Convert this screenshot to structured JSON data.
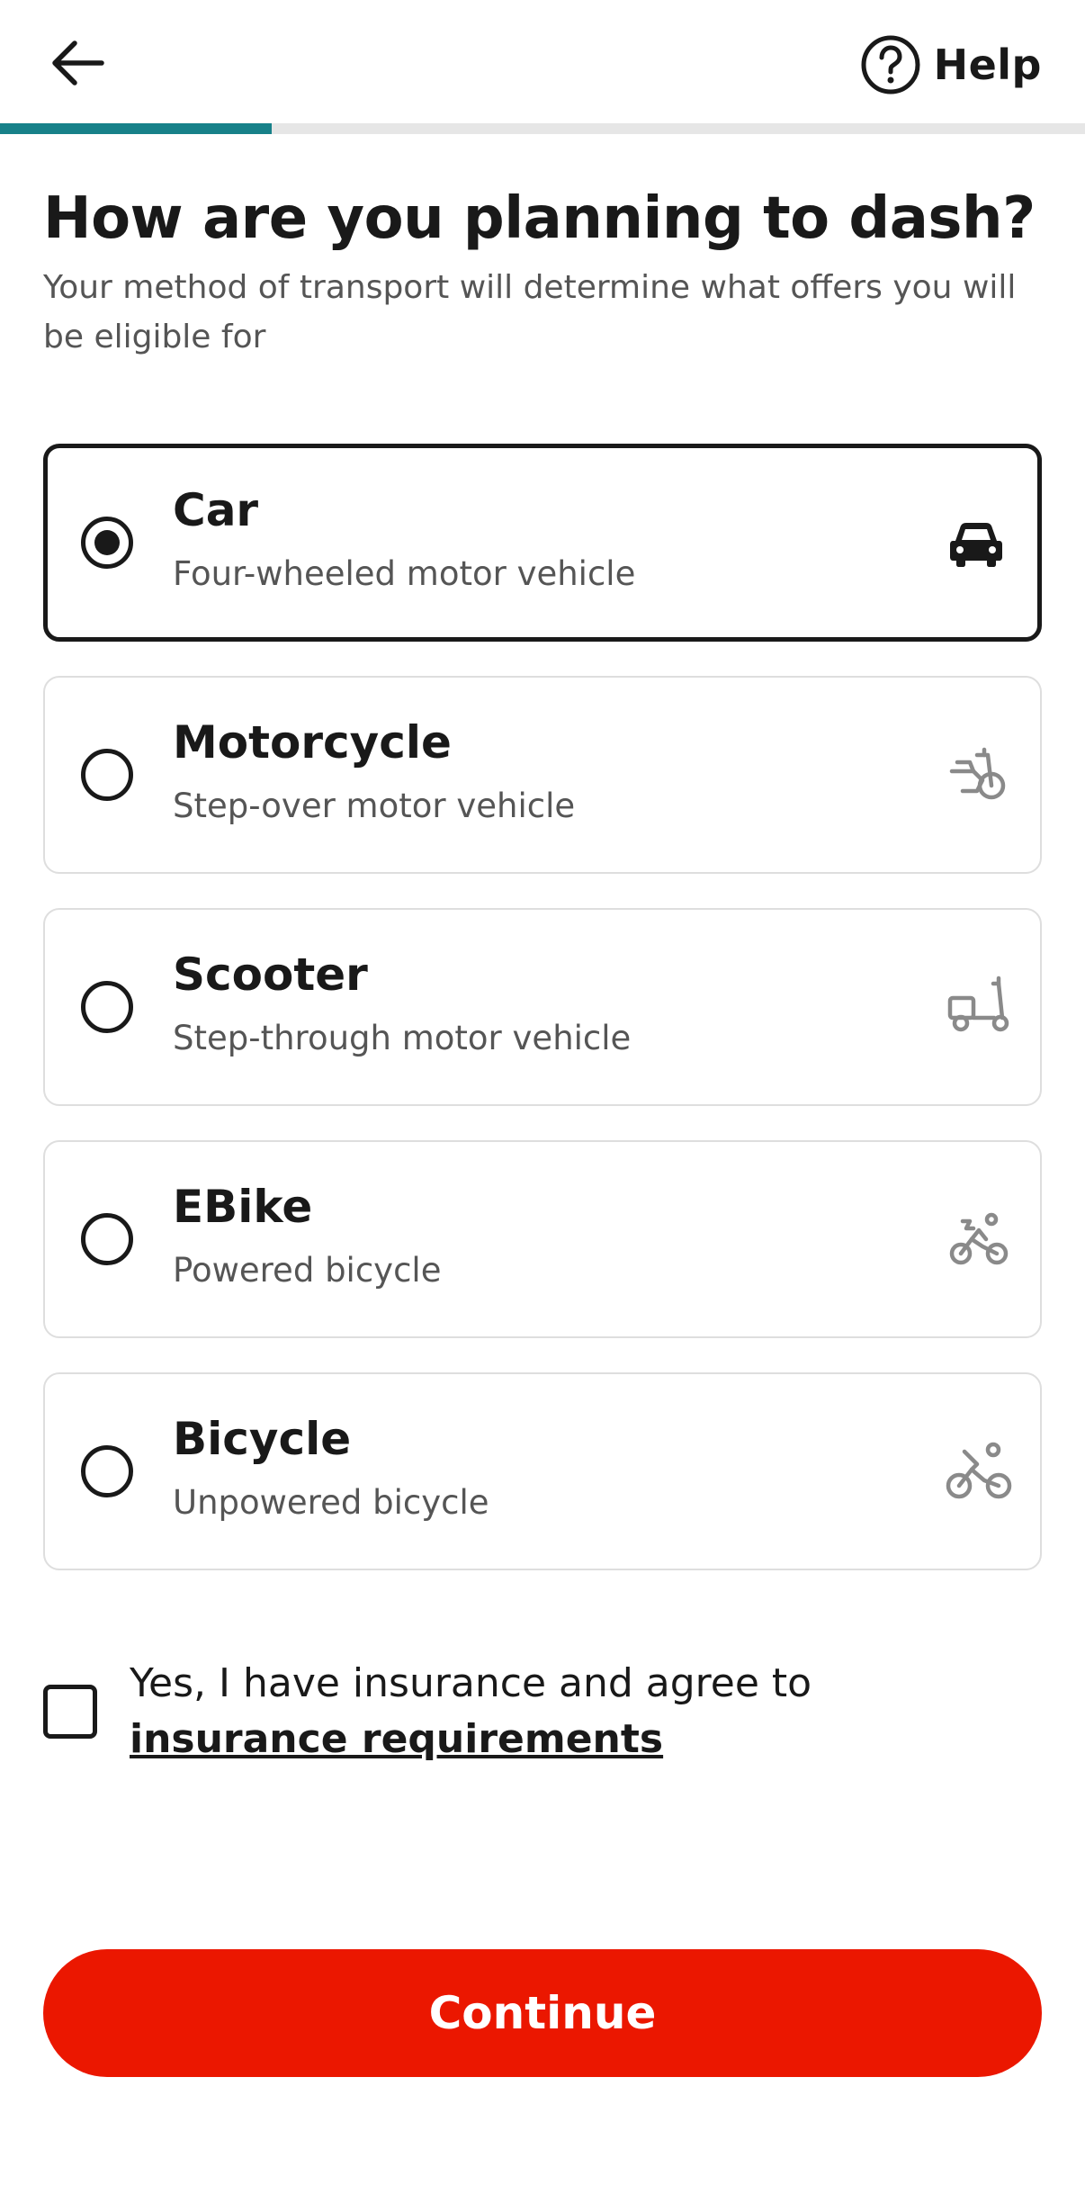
{
  "header": {
    "back_icon": "arrow-left-icon",
    "help_icon": "question-circle-icon",
    "help_label": "Help"
  },
  "progress": {
    "fraction": 0.25,
    "fill_color": "#178189",
    "track_color": "#e6e6e6"
  },
  "title": "How are you planning to dash?",
  "subtitle": "Your method of transport will determine what offers you will be eligible for",
  "options": [
    {
      "title": "Car",
      "subtitle": "Four-wheeled motor vehicle",
      "icon": "car-icon",
      "selected": true
    },
    {
      "title": "Motorcycle",
      "subtitle": "Step-over motor vehicle",
      "icon": "motorcycle-icon",
      "selected": false
    },
    {
      "title": "Scooter",
      "subtitle": "Step-through motor vehicle",
      "icon": "scooter-icon",
      "selected": false
    },
    {
      "title": "EBike",
      "subtitle": "Powered bicycle",
      "icon": "ebike-icon",
      "selected": false
    },
    {
      "title": "Bicycle",
      "subtitle": "Unpowered bicycle",
      "icon": "bicycle-icon",
      "selected": false
    }
  ],
  "insurance": {
    "checked": false,
    "text": "Yes, I have insurance and agree to ",
    "link_text": "insurance requirements"
  },
  "continue_label": "Continue",
  "colors": {
    "primary": "#eb1700",
    "text": "#191919",
    "muted": "#555555",
    "icon_inactive": "#8a8a8a"
  }
}
